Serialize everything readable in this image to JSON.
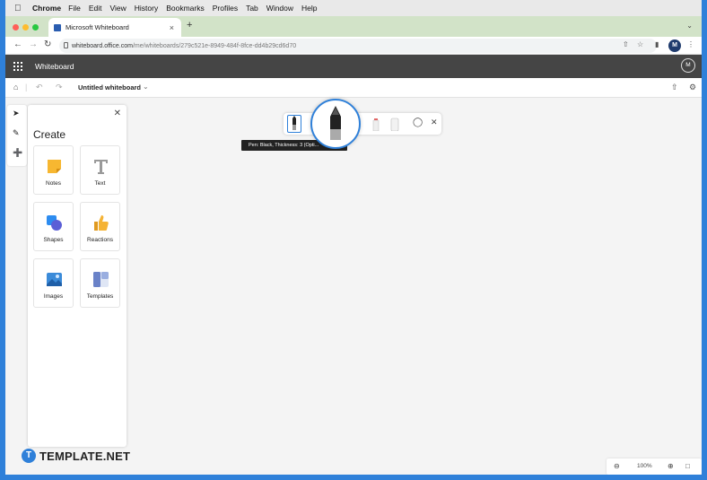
{
  "menubar": {
    "app_name": "Chrome",
    "items": [
      "File",
      "Edit",
      "View",
      "History",
      "Bookmarks",
      "Profiles",
      "Tab",
      "Window",
      "Help"
    ]
  },
  "browser": {
    "tab_title": "Microsoft Whiteboard",
    "url_host": "whiteboard.office.com",
    "url_path": "/me/whiteboards/279c521e-8949-484f-8fce-dd4b29cd6d70",
    "profile_initial": "M"
  },
  "app": {
    "name": "Whiteboard",
    "user_initial": "M",
    "whiteboard_title": "Untitled whiteboard"
  },
  "panel": {
    "title": "Create",
    "tiles": [
      "Notes",
      "Text",
      "Shapes",
      "Reactions",
      "Images",
      "Templates"
    ]
  },
  "pen_toolbar": {
    "tooltip": "Pen: Black, Thickness: 3 (Opti..."
  },
  "zoom": {
    "level": "100%"
  },
  "watermark": {
    "logo_letter": "T",
    "text": "TEMPLATE.NET"
  },
  "colors": {
    "accent": "#2f80d9",
    "tabstrip": "#d2e3c8",
    "app_header": "#454545",
    "canvas": "#f4f4f4",
    "notes": "#f7b731",
    "shapes": "#2d8cf0",
    "reactions": "#f5b335",
    "images": "#3b8bd9",
    "templates": "#6a82c8"
  }
}
